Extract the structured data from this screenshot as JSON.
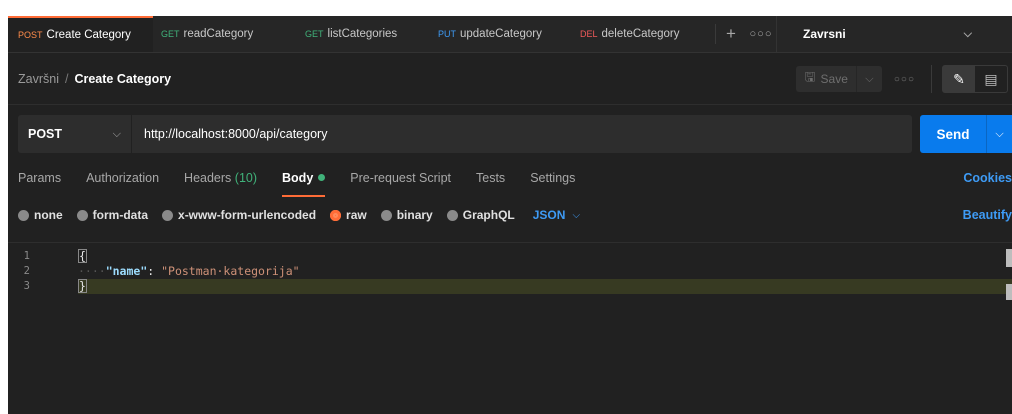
{
  "tabs": [
    {
      "method": "POST",
      "name": "Create Category",
      "method_color": "#ff8c4a"
    },
    {
      "method": "GET",
      "name": "readCategory",
      "method_color": "#40b27a"
    },
    {
      "method": "GET",
      "name": "listCategories",
      "method_color": "#40b27a"
    },
    {
      "method": "PUT",
      "name": "updateCategory",
      "method_color": "#3e9bf5"
    },
    {
      "method": "DEL",
      "name": "deleteCategory",
      "method_color": "#f05a5a"
    }
  ],
  "environment": "Zavrsni",
  "breadcrumb": {
    "collection": "Završni",
    "separator": "/",
    "current": "Create Category"
  },
  "save_label": "Save",
  "request": {
    "method": "POST",
    "url": "http://localhost:8000/api/category",
    "send_label": "Send"
  },
  "request_tabs": {
    "params": "Params",
    "authorization": "Authorization",
    "headers": "Headers",
    "headers_count": "(10)",
    "body": "Body",
    "prerequest": "Pre-request Script",
    "tests": "Tests",
    "settings": "Settings",
    "cookies": "Cookies"
  },
  "body_options": {
    "none": "none",
    "form_data": "form-data",
    "urlencoded": "x-www-form-urlencoded",
    "raw": "raw",
    "binary": "binary",
    "graphql": "GraphQL",
    "format": "JSON",
    "beautify": "Beautify"
  },
  "editor": {
    "line_numbers": [
      "1",
      "2",
      "3"
    ],
    "open_brace": "{",
    "indent": "····",
    "key": "\"name\"",
    "colon": ": ",
    "value": "\"Postman·kategorija\"",
    "close_brace": "}"
  },
  "colors": {
    "accent": "#ff6c37",
    "send": "#097bed",
    "link": "#3e9bf5"
  }
}
